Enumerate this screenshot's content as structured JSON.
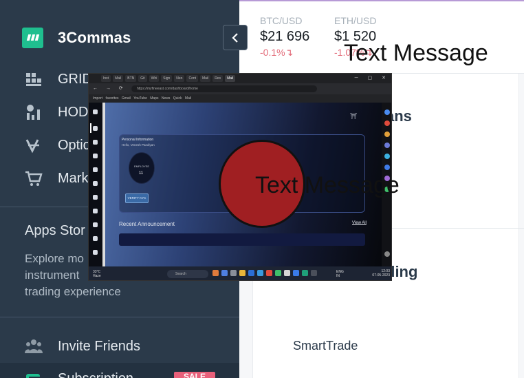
{
  "sidebar": {
    "brand": "3Commas",
    "collapse_icon": "chevron-left-icon",
    "items": [
      {
        "label": "GRID",
        "icon": "grid-icon"
      },
      {
        "label": "HOD",
        "icon": "hodl-icon"
      },
      {
        "label": "Optio",
        "icon": "options-icon"
      },
      {
        "label": "Mark",
        "icon": "cart-icon"
      }
    ],
    "apps_store_title": "Apps Stor",
    "apps_store_desc_lines": [
      "Explore mo",
      "instrument",
      "trading experience"
    ],
    "invite_label": "Invite Friends",
    "subscription_label": "Subscription",
    "sale_badge": "SALE"
  },
  "tickers": [
    {
      "pair": "BTC/USD",
      "price": "$21 696",
      "change": "-0.1%"
    },
    {
      "pair": "ETH/USD",
      "price": "$1 520",
      "change": "-1.07%"
    }
  ],
  "overlay_text": "Text Message",
  "main": {
    "heading_1": "ans",
    "heading_2": "ding",
    "smarttrade": "SmartTrade"
  },
  "embedded": {
    "tabs": [
      "Inst",
      "Mail",
      "BTN",
      "Git",
      "Whi",
      "Sign",
      "Neo",
      "Cont",
      "Mail",
      "Res",
      "Mail"
    ],
    "url": "https://myfineeast.com/dashboard/home",
    "bookmarks": "Import favorites  Gmail  YouTube  Maps  News  Quick Mail",
    "personal_info_title": "Personal Information",
    "personal_info_name": "Hello, Venesh Pandiyan",
    "employee_id_label": "EMPLOYEE",
    "employee_id_value": "11",
    "kyc_button": "VERIFY KYC",
    "recent_announcement": "Recent Announcement",
    "view_all": "View All",
    "weather_temp": "33°C",
    "weather_desc": "Haze",
    "search_label": "Search",
    "tray_lang": "ENG",
    "tray_region": "IN",
    "clock_time": "12:03",
    "clock_date": "07-05-2023"
  },
  "colors": {
    "sidebar_bg": "#2b3a4a",
    "brand_green": "#1fbf8f",
    "negative": "#e26a78",
    "red_circle": "#a01f22",
    "sale_badge": "#e8607a"
  }
}
